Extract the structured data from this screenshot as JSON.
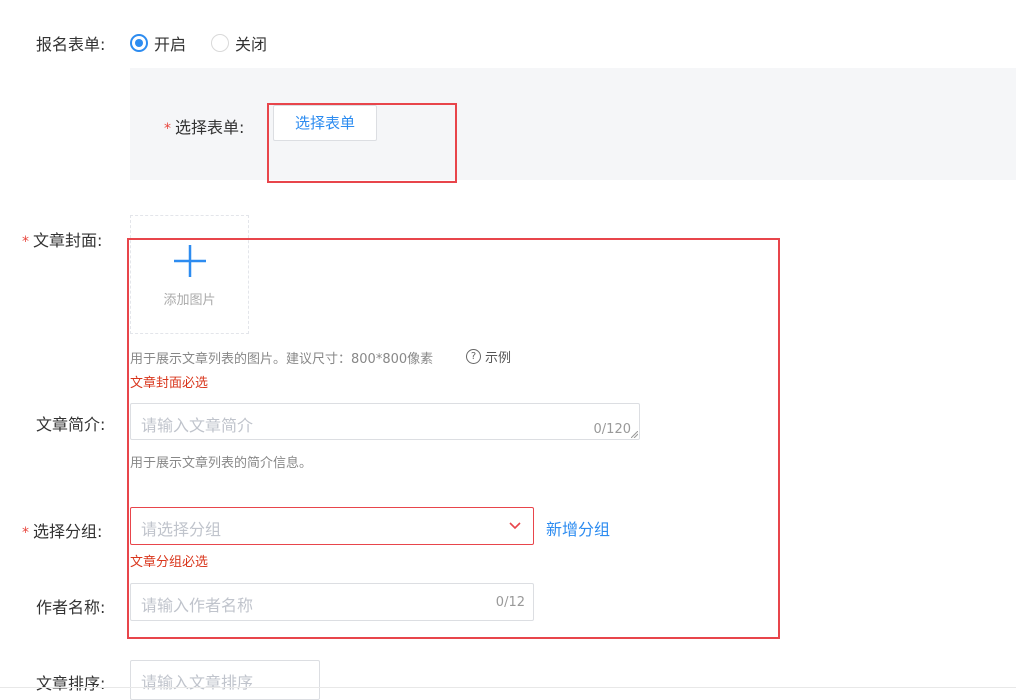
{
  "form": {
    "signup_form": {
      "label": "报名表单:",
      "options": [
        {
          "label": "开启",
          "selected": true
        },
        {
          "label": "关闭",
          "selected": false
        }
      ]
    },
    "select_form": {
      "label": "选择表单:",
      "required_mark": "*",
      "button_label": "选择表单"
    },
    "cover": {
      "label": "文章封面:",
      "required_mark": "*",
      "upload_text": "添加图片",
      "hint": "用于展示文章列表的图片。建议尺寸：800*800像素",
      "example_icon": "?",
      "example_label": "示例",
      "error": "文章封面必选"
    },
    "intro": {
      "label": "文章简介:",
      "placeholder": "请输入文章简介",
      "counter": "0/120",
      "hint": "用于展示文章列表的简介信息。"
    },
    "group": {
      "label": "选择分组:",
      "required_mark": "*",
      "placeholder": "请选择分组",
      "add_link": "新增分组",
      "error": "文章分组必选"
    },
    "author": {
      "label": "作者名称:",
      "placeholder": "请输入作者名称",
      "counter": "0/12"
    },
    "sort": {
      "label": "文章排序:",
      "placeholder": "请输入文章排序"
    }
  },
  "colors": {
    "accent": "#2d8cf0",
    "highlight_box": "#e8454b",
    "error": "#d9361c",
    "panel_bg": "#f5f6f8"
  }
}
